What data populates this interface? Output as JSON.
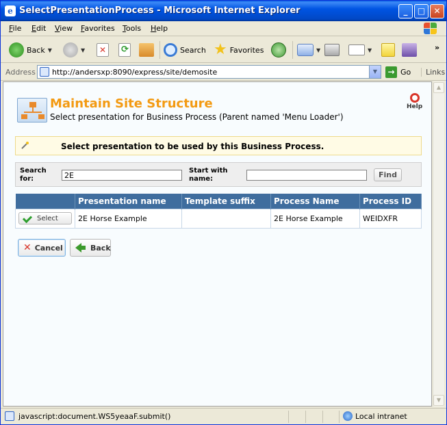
{
  "window": {
    "title": "SelectPresentationProcess - Microsoft Internet Explorer",
    "controls": {
      "minimize": "_",
      "maximize": "□",
      "close": "✕"
    }
  },
  "menu": [
    "File",
    "Edit",
    "View",
    "Favorites",
    "Tools",
    "Help"
  ],
  "toolbar": {
    "back_label": "Back",
    "search_label": "Search",
    "favorites_label": "Favorites",
    "more": "»"
  },
  "address": {
    "label": "Address",
    "url": "http://andersxp:8090/express/site/demosite",
    "go_label": "Go",
    "links_label": "Links"
  },
  "page": {
    "title": "Maintain Site Structure",
    "subtitle": "Select presentation for Business Process (Parent named 'Menu Loader')",
    "help_label": "Help",
    "notice": "Select presentation to be used by this Business Process."
  },
  "search": {
    "search_for_label": "Search\nfor:",
    "search_for_value": "2E",
    "start_with_label": "Start with\nname:",
    "start_with_value": "",
    "find_label": "Find"
  },
  "table": {
    "columns": [
      "",
      "Presentation name",
      "Template suffix",
      "Process Name",
      "Process ID"
    ],
    "rows": [
      {
        "action": "Select",
        "presentation_name": "2E Horse Example",
        "template_suffix": "",
        "process_name": "2E Horse Example",
        "process_id": "WEIDXFR"
      }
    ]
  },
  "buttons": {
    "cancel": "Cancel",
    "back": "Back"
  },
  "status": {
    "text": "javascript:document.WS5yeaaF.submit()",
    "zone": "Local intranet"
  },
  "colors": {
    "title_orange": "#f39a12",
    "table_header": "#3f6d9e",
    "notice_bg": "#fffbe5",
    "xp_blue": "#0054e3"
  },
  "icons": {
    "back": "back-arrow-icon",
    "forward": "forward-arrow-icon",
    "stop": "stop-icon",
    "refresh": "refresh-icon",
    "home": "home-icon",
    "search": "magnifier-icon",
    "favorites": "star-icon",
    "history": "history-icon",
    "mail": "mail-icon",
    "print": "printer-icon",
    "edit": "edit-icon",
    "discuss": "note-icon",
    "research": "research-icon"
  }
}
